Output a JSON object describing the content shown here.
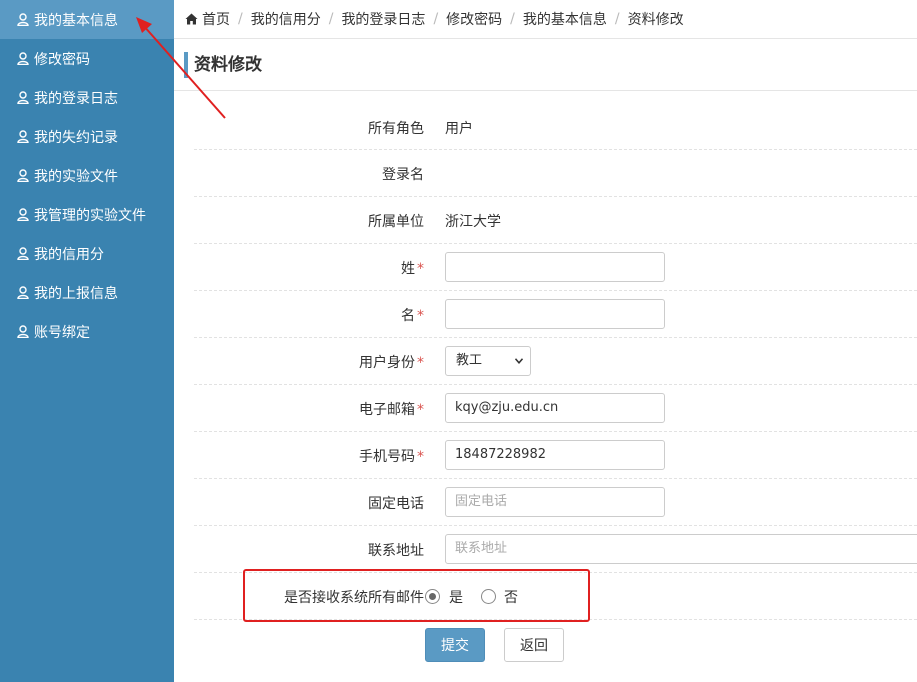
{
  "sidebar": {
    "items": [
      {
        "label": "我的基本信息",
        "active": true
      },
      {
        "label": "修改密码"
      },
      {
        "label": "我的登录日志"
      },
      {
        "label": "我的失约记录"
      },
      {
        "label": "我的实验文件"
      },
      {
        "label": "我管理的实验文件"
      },
      {
        "label": "我的信用分"
      },
      {
        "label": "我的上报信息"
      },
      {
        "label": "账号绑定"
      }
    ]
  },
  "breadcrumb": [
    "首页",
    "我的信用分",
    "我的登录日志",
    "修改密码",
    "我的基本信息",
    "资料修改"
  ],
  "page_title": "资料修改",
  "form": {
    "role": {
      "label": "所有角色",
      "value": "用户"
    },
    "login": {
      "label": "登录名",
      "value": ""
    },
    "unit": {
      "label": "所属单位",
      "value": "浙江大学"
    },
    "surname": {
      "label": "姓",
      "required": "*",
      "value": ""
    },
    "given_name": {
      "label": "名",
      "required": "*",
      "value": ""
    },
    "identity": {
      "label": "用户身份",
      "required": "*",
      "value": "教工"
    },
    "email": {
      "label": "电子邮箱",
      "required": "*",
      "value": "kqy@zju.edu.cn"
    },
    "mobile": {
      "label": "手机号码",
      "required": "*",
      "value": "18487228982"
    },
    "phone": {
      "label": "固定电话",
      "placeholder": "固定电话"
    },
    "address": {
      "label": "联系地址",
      "placeholder": "联系地址"
    },
    "receive_mail": {
      "label": "是否接收系统所有邮件",
      "yes": "是",
      "no": "否",
      "selected": "是"
    }
  },
  "buttons": {
    "submit": "提交",
    "back": "返回"
  },
  "colors": {
    "sidebar": "#3a83b0",
    "sidebar_active": "#5a9ac4",
    "accent": "#5a9ac4",
    "annotation": "#e02020",
    "required": "#d9534f"
  }
}
